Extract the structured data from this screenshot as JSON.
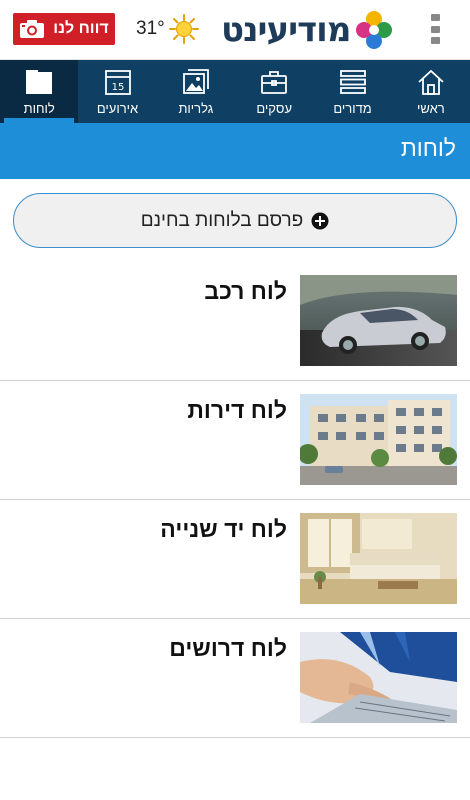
{
  "header": {
    "report_button_label": "דווח לנו",
    "temperature": "31°",
    "logo_text": "מודיעינט"
  },
  "nav": {
    "items": [
      {
        "label": "ראשי",
        "icon": "home-icon"
      },
      {
        "label": "מדורים",
        "icon": "sections-icon"
      },
      {
        "label": "עסקים",
        "icon": "briefcase-icon"
      },
      {
        "label": "גלריות",
        "icon": "gallery-icon"
      },
      {
        "label": "אירועים",
        "icon": "calendar-icon",
        "calendar_day": "15"
      },
      {
        "label": "לוחות",
        "icon": "boards-icon",
        "active": true
      }
    ]
  },
  "page": {
    "title": "לוחות",
    "publish_button_label": "פרסם בלוחות בחינם"
  },
  "boards": [
    {
      "name": "לוח רכב",
      "image": "car-photo"
    },
    {
      "name": "לוח דירות",
      "image": "apartments-photo"
    },
    {
      "name": "לוח יד שנייה",
      "image": "living-room-photo"
    },
    {
      "name": "לוח דרושים",
      "image": "laptop-hand-photo"
    }
  ],
  "colors": {
    "report_red": "#d01f26",
    "nav_blue": "#0f3f63",
    "accent_blue": "#1f8ed8"
  }
}
